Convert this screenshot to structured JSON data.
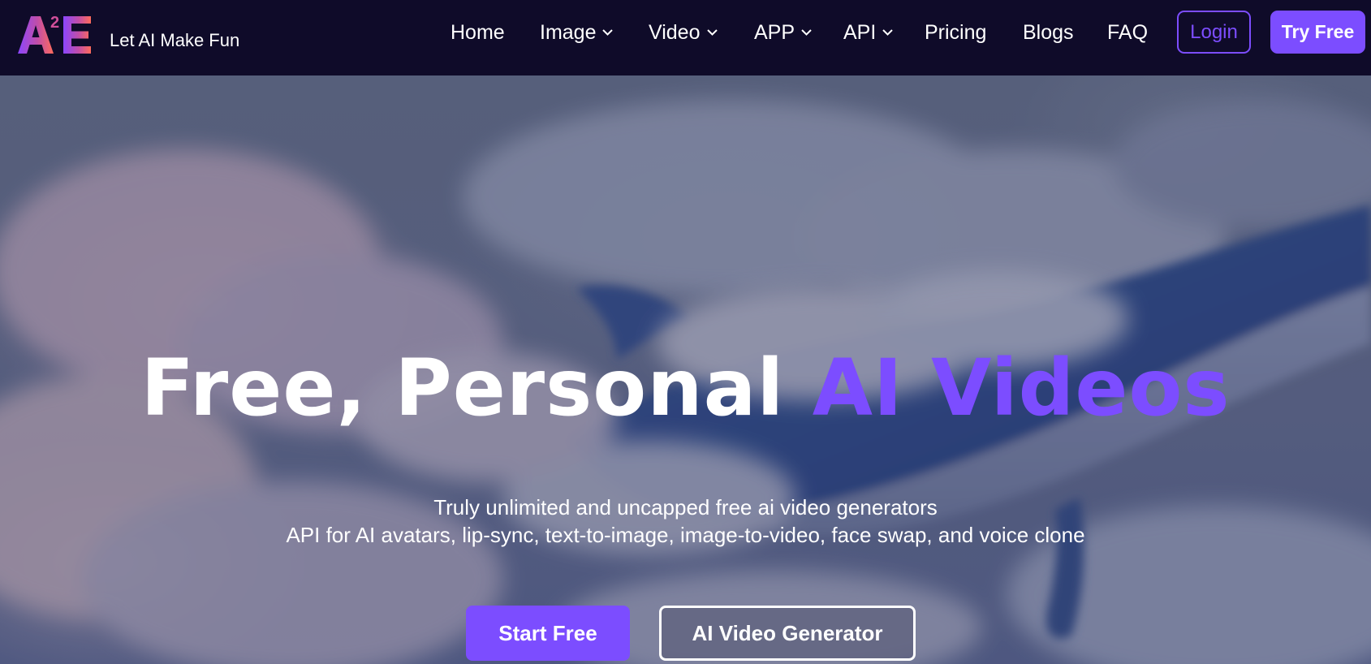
{
  "brand": {
    "logo_text": "A2E",
    "tagline": "Let AI Make Fun",
    "logo_colors": [
      "#8b46ff",
      "#c14ea8",
      "#ff6b5a"
    ]
  },
  "nav": {
    "items": [
      {
        "label": "Home",
        "has_dropdown": false
      },
      {
        "label": "Image",
        "has_dropdown": true
      },
      {
        "label": "Video",
        "has_dropdown": true
      },
      {
        "label": "APP",
        "has_dropdown": true
      },
      {
        "label": "API",
        "has_dropdown": true
      },
      {
        "label": "Pricing",
        "has_dropdown": false
      },
      {
        "label": "Blogs",
        "has_dropdown": false
      },
      {
        "label": "FAQ",
        "has_dropdown": false
      }
    ],
    "login_label": "Login",
    "try_free_label": "Try Free",
    "dropdown_icon": "chevron-down-icon"
  },
  "hero": {
    "headline_plain": "Free, Personal ",
    "headline_accent": "AI Videos",
    "subtitle_line1": "Truly unlimited and uncapped free ai video generators",
    "subtitle_line2": "API for AI avatars, lip-sync, text-to-image, image-to-video, face swap, and voice clone",
    "primary_cta": "Start Free",
    "secondary_cta": "AI Video Generator",
    "background_image": "whale-in-clouds"
  },
  "colors": {
    "header_bg": "#0f0b29",
    "accent": "#7c4dff",
    "text": "#ffffff"
  }
}
